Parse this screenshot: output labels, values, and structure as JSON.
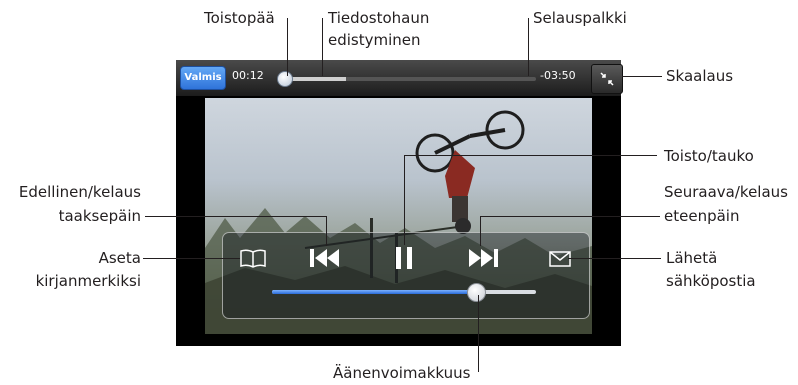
{
  "player": {
    "done_label": "Valmis",
    "time_elapsed": "00:12",
    "time_remaining": "-03:50",
    "download_progress_fraction": 0.26,
    "playhead_fraction": 0.0,
    "volume_fraction": 0.77,
    "accent_color": "#3a86e8"
  },
  "callouts": {
    "playhead": "Toistopää",
    "download_progress_line1": "Tiedostohaun",
    "download_progress_line2": "edistyminen",
    "scrubber": "Selauspalkki",
    "scale": "Skaalaus",
    "play_pause": "Toisto/tauko",
    "prev_line1": "Edellinen/kelaus",
    "prev_line2": "taaksepäin",
    "next_line1": "Seuraava/kelaus",
    "next_line2": "eteenpäin",
    "bookmark_line1": "Aseta",
    "bookmark_line2": "kirjanmerkiksi",
    "email_line1": "Lähetä",
    "email_line2": "sähköpostia",
    "volume": "Äänenvoimakkuus"
  },
  "icons": {
    "bookmark": "book-icon",
    "previous": "skip-back-icon",
    "pause": "pause-icon",
    "next": "skip-forward-icon",
    "email": "envelope-icon",
    "scale": "scale-arrows-icon"
  }
}
